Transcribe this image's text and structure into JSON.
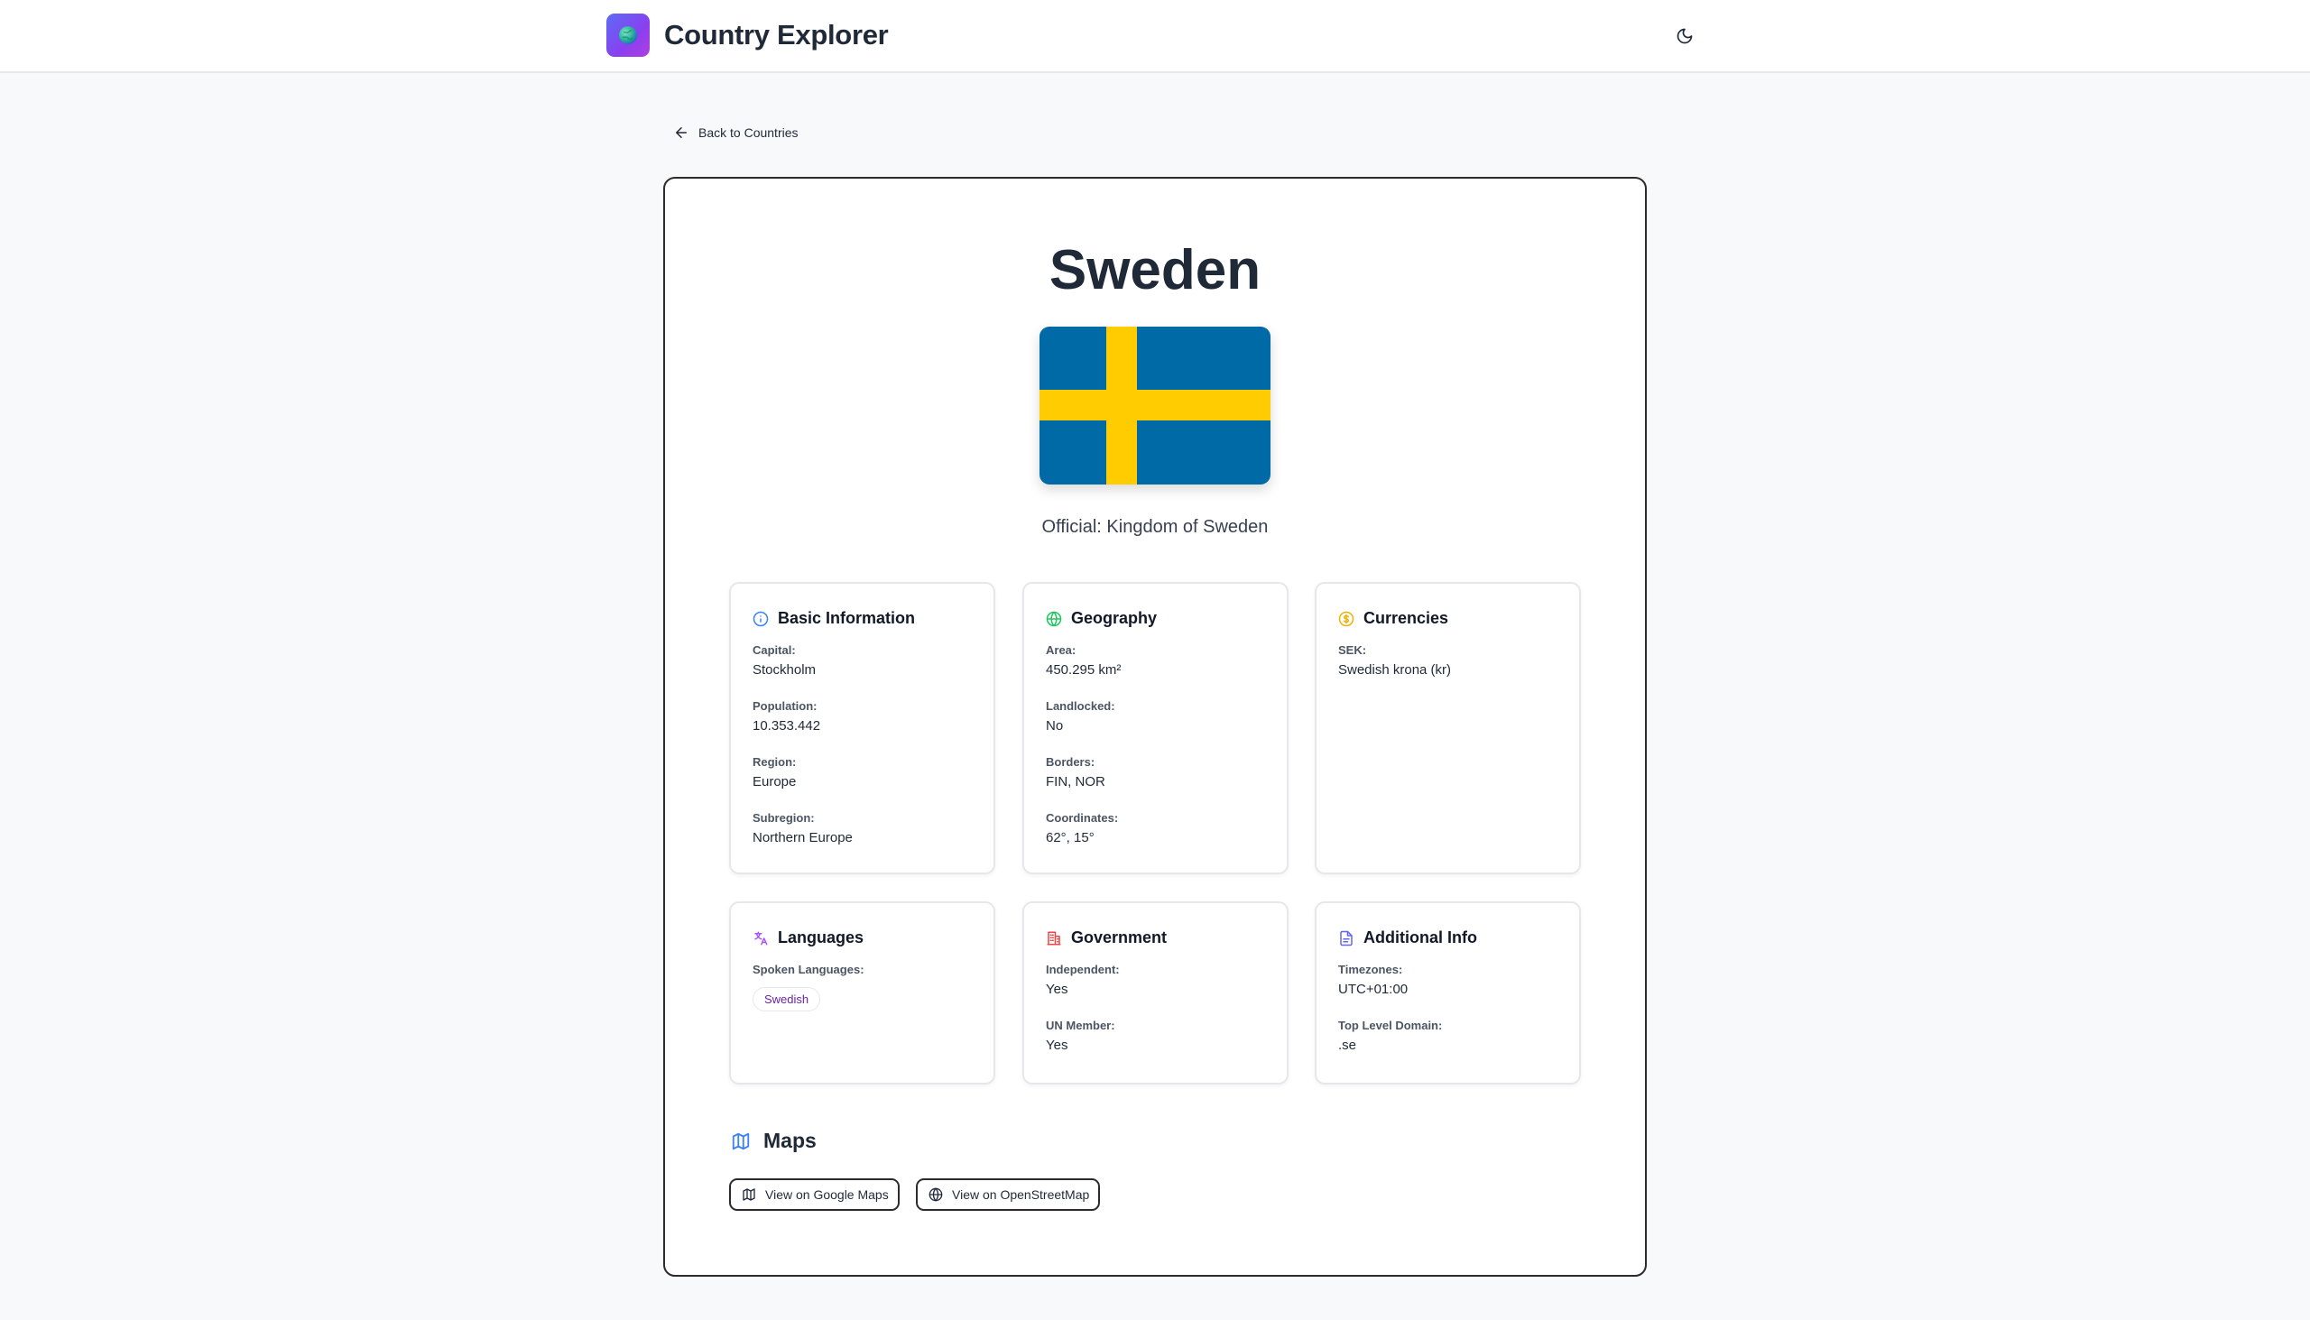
{
  "header": {
    "app_title": "Country Explorer",
    "logo_icon": "globe-icon",
    "theme_toggle_icon": "moon-icon"
  },
  "nav": {
    "back_label": "Back to Countries"
  },
  "country": {
    "name": "Sweden",
    "official": "Official: Kingdom of Sweden",
    "flag_colors": {
      "blue": "#006aa7",
      "yellow": "#fecc00"
    }
  },
  "basic_info": {
    "title": "Basic Information",
    "capital_label": "Capital:",
    "capital": "Stockholm",
    "population_label": "Population:",
    "population": "10.353.442",
    "region_label": "Region:",
    "region": "Europe",
    "subregion_label": "Subregion:",
    "subregion": "Northern Europe"
  },
  "geography": {
    "title": "Geography",
    "area_label": "Area:",
    "area": "450.295 km²",
    "landlocked_label": "Landlocked:",
    "landlocked": "No",
    "borders_label": "Borders:",
    "borders": "FIN, NOR",
    "coordinates_label": "Coordinates:",
    "coordinates": "62°, 15°"
  },
  "currencies": {
    "title": "Currencies",
    "code_label": "SEK:",
    "name": "Swedish krona (kr)"
  },
  "languages": {
    "title": "Languages",
    "spoken_label": "Spoken Languages:",
    "items": [
      "Swedish"
    ]
  },
  "government": {
    "title": "Government",
    "independent_label": "Independent:",
    "independent": "Yes",
    "un_label": "UN Member:",
    "un_member": "Yes"
  },
  "additional": {
    "title": "Additional Info",
    "timezones_label": "Timezones:",
    "timezones": "UTC+01:00",
    "tld_label": "Top Level Domain:",
    "tld": ".se"
  },
  "maps": {
    "title": "Maps",
    "google_label": "View on Google Maps",
    "osm_label": "View on OpenStreetMap"
  },
  "colors": {
    "info_icon": "#3b82f6",
    "geo_icon": "#22c55e",
    "currency_icon": "#eab308",
    "language_icon": "#a855f7",
    "government_icon": "#ef4444",
    "additional_icon": "#6366f1",
    "maps_icon": "#3b82f6"
  }
}
